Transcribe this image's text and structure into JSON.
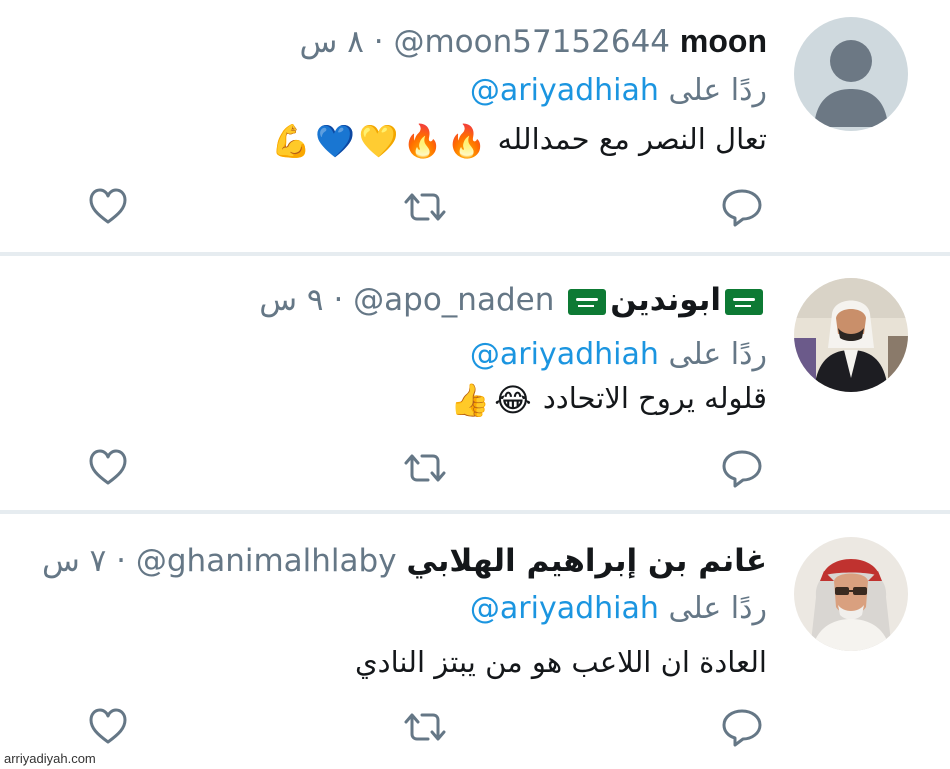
{
  "tweets": [
    {
      "name": "moon",
      "handle": "@moon57152644",
      "separator": "·",
      "time": "٨ س",
      "reply_prefix": "ردًا على",
      "reply_handle": "@ariyadhiah",
      "body_text": "تعال النصر مع حمدالله",
      "body_emojis": [
        "🔥",
        "🔥",
        "💛",
        "💙",
        "💪"
      ],
      "avatar": "default-silhouette"
    },
    {
      "name": "ابوندين",
      "name_flags": [
        "saudi-flag-icon",
        "saudi-flag-icon"
      ],
      "handle": "@apo_naden",
      "separator": "·",
      "time": "٩ س",
      "reply_prefix": "ردًا على",
      "reply_handle": "@ariyadhiah",
      "body_text": "قلوله يروح الاتحادد",
      "body_emojis": [
        "😂",
        "👍"
      ],
      "avatar": "user-photo"
    },
    {
      "name": "غانم بن إبراهيم الهلابي",
      "handle": "@ghanimalhlaby",
      "separator": "·",
      "time": "٧ س",
      "reply_prefix": "ردًا على",
      "reply_handle": "@ariyadhiah",
      "body_text": "العادة ان اللاعب هو من يبتز النادي",
      "body_emojis": [],
      "avatar": "user-photo"
    }
  ],
  "action_icons": [
    "reply-icon",
    "retweet-icon",
    "like-icon"
  ],
  "watermark": "arriyadiyah.com",
  "colors": {
    "link": "#1b95e0",
    "secondary_text": "#657786",
    "primary_text": "#14171a",
    "divider": "#e6ecf0",
    "icon": "#657786"
  }
}
